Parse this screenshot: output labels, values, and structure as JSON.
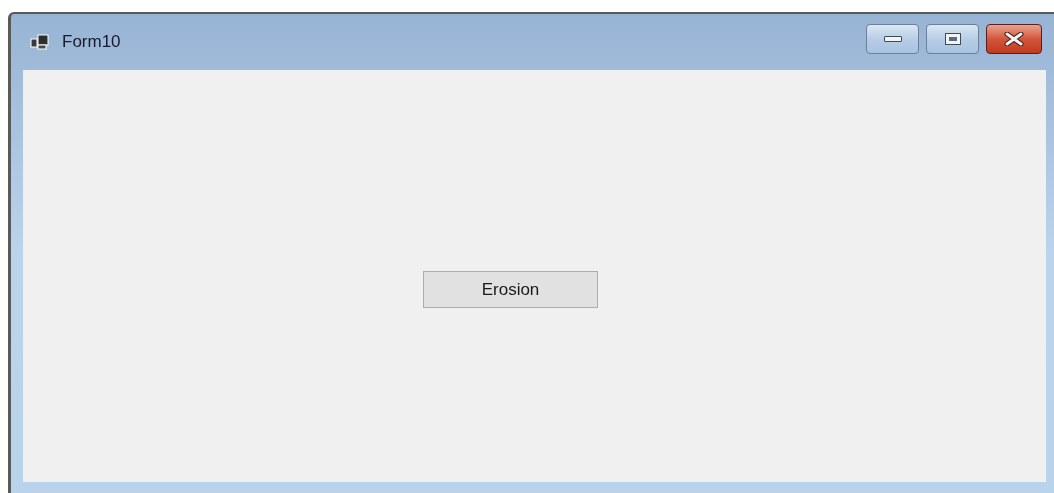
{
  "window": {
    "title": "Form10"
  },
  "buttons": [
    {
      "label": "Erosion"
    }
  ]
}
